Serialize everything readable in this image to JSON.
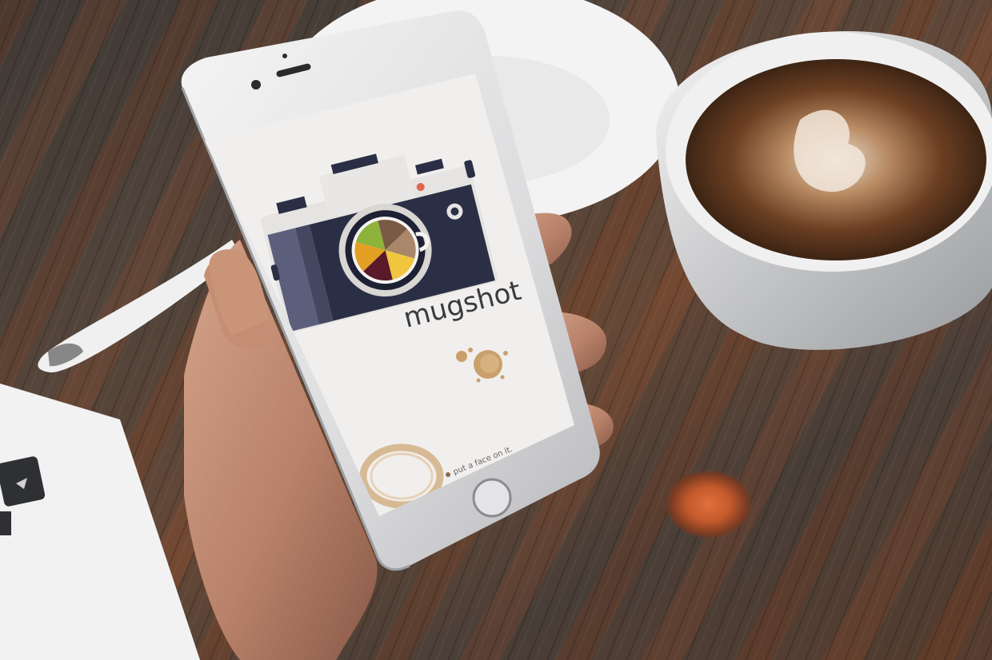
{
  "app": {
    "name": "mugshot",
    "footer_text": "put a face on it."
  },
  "colors": {
    "screen_background": "#f1efed",
    "camera_body_dark": "#2b2f45",
    "camera_body_panel": "#5c5f7c",
    "camera_top": "#e8e6e4",
    "lens_ring": "#d9d6d3",
    "stain_brown": "#c8a070"
  },
  "icons": {
    "app_logo": "camera-icon",
    "lens": "coffee-cup-icon"
  }
}
